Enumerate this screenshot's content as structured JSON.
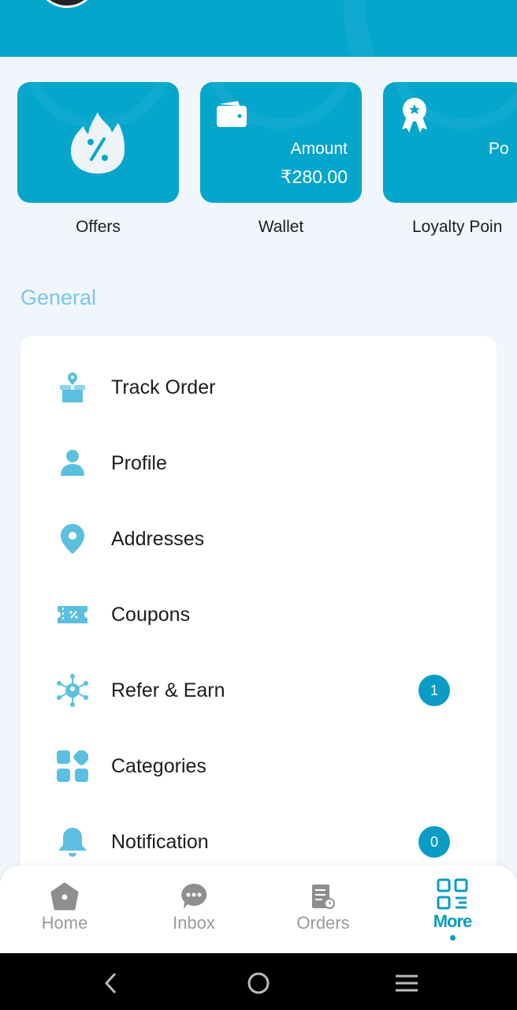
{
  "colors": {
    "accent": "#04a6cc",
    "icon": "#5bc0e0",
    "badge": "#0a9cc4",
    "section": "#7cc5ea"
  },
  "cards": [
    {
      "label": "Offers",
      "icon": "fire-percent-icon"
    },
    {
      "label": "Wallet",
      "icon": "wallet-icon",
      "line1": "Amount",
      "line2": "₹280.00"
    },
    {
      "label": "Loyalty Poin",
      "icon": "award-badge-icon",
      "line1": "Po"
    }
  ],
  "section_title": "General",
  "menu": [
    {
      "label": "Track Order",
      "icon": "box-location-icon"
    },
    {
      "label": "Profile",
      "icon": "person-icon"
    },
    {
      "label": "Addresses",
      "icon": "map-pin-icon"
    },
    {
      "label": "Coupons",
      "icon": "coupon-icon"
    },
    {
      "label": "Refer & Earn",
      "icon": "network-icon",
      "badge": "1"
    },
    {
      "label": "Categories",
      "icon": "grid-icon"
    },
    {
      "label": "Notification",
      "icon": "bell-icon",
      "badge": "0"
    }
  ],
  "nav": [
    {
      "label": "Home",
      "icon": "home-icon"
    },
    {
      "label": "Inbox",
      "icon": "chat-icon"
    },
    {
      "label": "Orders",
      "icon": "orders-icon"
    },
    {
      "label": "More",
      "icon": "more-grid-icon",
      "active": true
    }
  ]
}
